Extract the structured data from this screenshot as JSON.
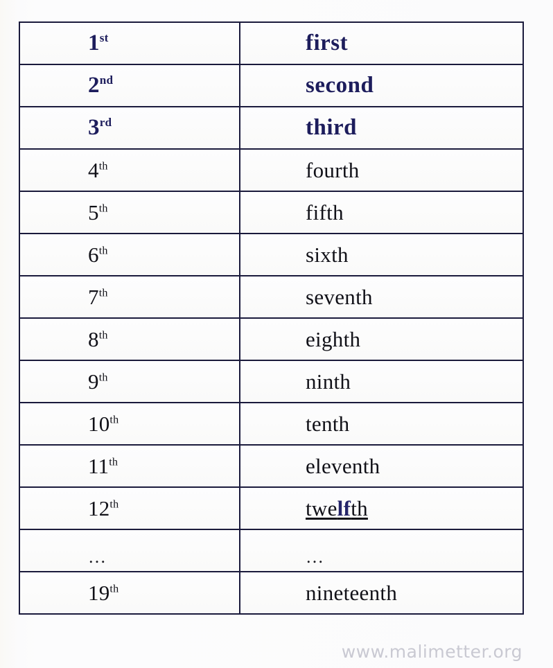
{
  "table": {
    "columns": [
      "numeral",
      "word"
    ],
    "rows": [
      {
        "numeral": "1",
        "suffix": "st",
        "word": "first",
        "style": "highlight"
      },
      {
        "numeral": "2",
        "suffix": "nd",
        "word": "second",
        "style": "highlight"
      },
      {
        "numeral": "3",
        "suffix": "rd",
        "word": "third",
        "style": "highlight"
      },
      {
        "numeral": "4",
        "suffix": "th",
        "word": "fourth",
        "style": "normal"
      },
      {
        "numeral": "5",
        "suffix": "th",
        "word": "fifth",
        "style": "normal"
      },
      {
        "numeral": "6",
        "suffix": "th",
        "word": "sixth",
        "style": "normal"
      },
      {
        "numeral": "7",
        "suffix": "th",
        "word": "seventh",
        "style": "normal"
      },
      {
        "numeral": "8",
        "suffix": "th",
        "word": "eighth",
        "style": "normal"
      },
      {
        "numeral": "9",
        "suffix": "th",
        "word": "ninth",
        "style": "normal"
      },
      {
        "numeral": "10",
        "suffix": "th",
        "word": "tenth",
        "style": "normal"
      },
      {
        "numeral": "11",
        "suffix": "th",
        "word": "eleventh",
        "style": "normal"
      },
      {
        "numeral": "12",
        "suffix": "th",
        "word": "twelfth",
        "style": "normal",
        "word_parts": [
          {
            "text": "twe",
            "accent": false
          },
          {
            "text": "lf",
            "accent": true
          },
          {
            "text": "th",
            "accent": false
          }
        ],
        "word_underlined": true
      },
      {
        "numeral": "…",
        "suffix": "",
        "word": "…",
        "style": "ellipsis"
      },
      {
        "numeral": "19",
        "suffix": "th",
        "word": "nineteenth",
        "style": "normal"
      }
    ]
  },
  "watermark": {
    "text": "www.malimetter.org"
  },
  "colors": {
    "accent_navy": "#1d1d5c",
    "border": "#1a1a3c",
    "text": "#111118",
    "watermark": "#c9c9d2",
    "page_background": "#fbfbfa",
    "cell_background": "#fcfcfd"
  }
}
